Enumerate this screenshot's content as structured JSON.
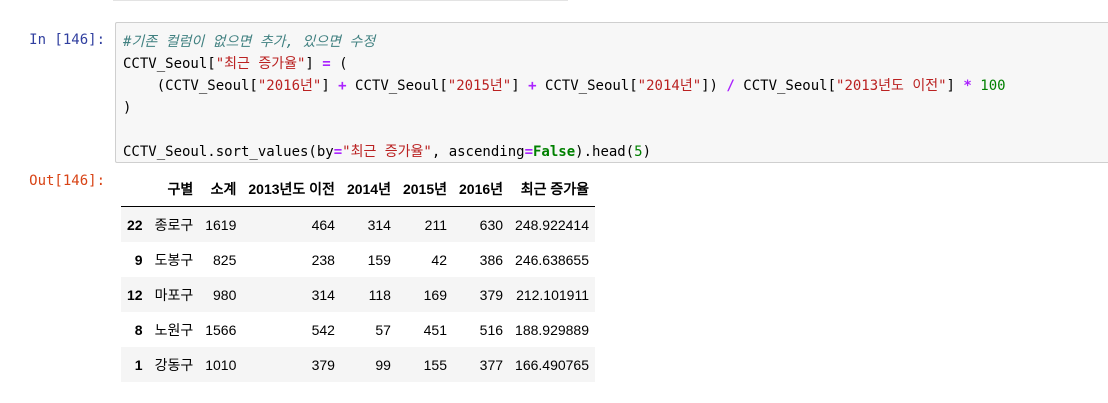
{
  "cell": {
    "input_prompt": "In [146]:",
    "output_prompt": "Out[146]:",
    "code_lines": [
      [
        {
          "t": "#기존 컬럼이 없으면 추가, 있으면 수정",
          "c": "comment"
        }
      ],
      [
        {
          "t": "CCTV_Seoul[",
          "c": ""
        },
        {
          "t": "\"최근 증가율\"",
          "c": "str"
        },
        {
          "t": "] ",
          "c": ""
        },
        {
          "t": "=",
          "c": "op"
        },
        {
          "t": " (",
          "c": ""
        }
      ],
      [
        {
          "t": "    (CCTV_Seoul[",
          "c": ""
        },
        {
          "t": "\"2016년\"",
          "c": "str"
        },
        {
          "t": "] ",
          "c": ""
        },
        {
          "t": "+",
          "c": "op"
        },
        {
          "t": " CCTV_Seoul[",
          "c": ""
        },
        {
          "t": "\"2015년\"",
          "c": "str"
        },
        {
          "t": "] ",
          "c": ""
        },
        {
          "t": "+",
          "c": "op"
        },
        {
          "t": " CCTV_Seoul[",
          "c": ""
        },
        {
          "t": "\"2014년\"",
          "c": "str"
        },
        {
          "t": "]) ",
          "c": ""
        },
        {
          "t": "/",
          "c": "op"
        },
        {
          "t": " CCTV_Seoul[",
          "c": ""
        },
        {
          "t": "\"2013년도 이전\"",
          "c": "str"
        },
        {
          "t": "] ",
          "c": ""
        },
        {
          "t": "*",
          "c": "op"
        },
        {
          "t": " ",
          "c": ""
        },
        {
          "t": "100",
          "c": "num"
        }
      ],
      [
        {
          "t": ")",
          "c": ""
        }
      ],
      [
        {
          "t": "",
          "c": ""
        }
      ],
      [
        {
          "t": "CCTV_Seoul.sort_values(by",
          "c": ""
        },
        {
          "t": "=",
          "c": "op"
        },
        {
          "t": "\"최근 증가율\"",
          "c": "str"
        },
        {
          "t": ", ascending",
          "c": ""
        },
        {
          "t": "=",
          "c": "op"
        },
        {
          "t": "False",
          "c": "kw"
        },
        {
          "t": ").head(",
          "c": ""
        },
        {
          "t": "5",
          "c": "num"
        },
        {
          "t": ")",
          "c": ""
        }
      ]
    ]
  },
  "table": {
    "columns": [
      "",
      "구별",
      "소계",
      "2013년도 이전",
      "2014년",
      "2015년",
      "2016년",
      "최근 증가율"
    ],
    "rows": [
      [
        "22",
        "종로구",
        "1619",
        "464",
        "314",
        "211",
        "630",
        "248.922414"
      ],
      [
        "9",
        "도봉구",
        "825",
        "238",
        "159",
        "42",
        "386",
        "246.638655"
      ],
      [
        "12",
        "마포구",
        "980",
        "314",
        "118",
        "169",
        "379",
        "212.101911"
      ],
      [
        "8",
        "노원구",
        "1566",
        "542",
        "57",
        "451",
        "516",
        "188.929889"
      ],
      [
        "1",
        "강동구",
        "1010",
        "379",
        "99",
        "155",
        "377",
        "166.490765"
      ]
    ]
  }
}
